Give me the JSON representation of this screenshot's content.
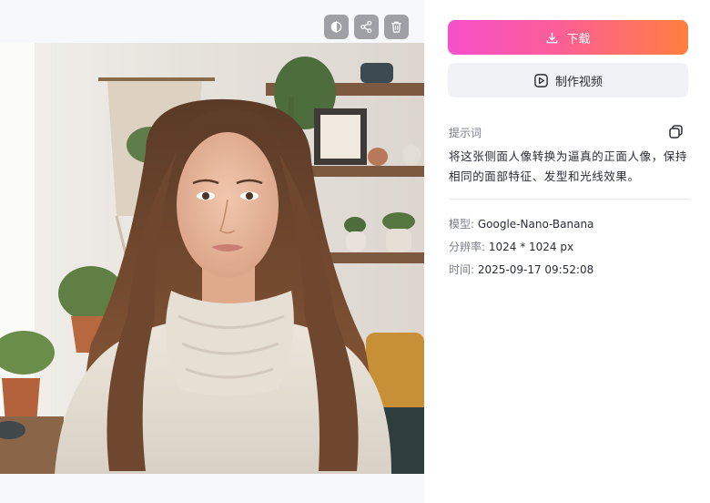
{
  "toolbar": {
    "buttons": [
      {
        "icon": "contrast-compare-icon"
      },
      {
        "icon": "share-icon"
      },
      {
        "icon": "trash-icon"
      }
    ]
  },
  "preview": {
    "image": "portrait-woman-cream-turtleneck"
  },
  "actions": {
    "download_label": "下载",
    "make_video_label": "制作视频"
  },
  "prompt": {
    "label": "提示词",
    "text": "将这张侧面人像转换为逼真的正面人像，保持相同的面部特征、发型和光线效果。"
  },
  "meta": {
    "model_key": "模型: ",
    "model_value": "Google-Nano-Banana",
    "resolution_key": "分辨率: ",
    "resolution_value": "1024 * 1024 px",
    "time_key": "时间: ",
    "time_value": "2025-09-17 09:52:08"
  },
  "colors": {
    "download_gradient_start": "#f64fcb",
    "download_gradient_end": "#ff7f3f",
    "tool_button_bg": "#9ea0a6",
    "secondary_button_bg": "#f1f2f5"
  }
}
